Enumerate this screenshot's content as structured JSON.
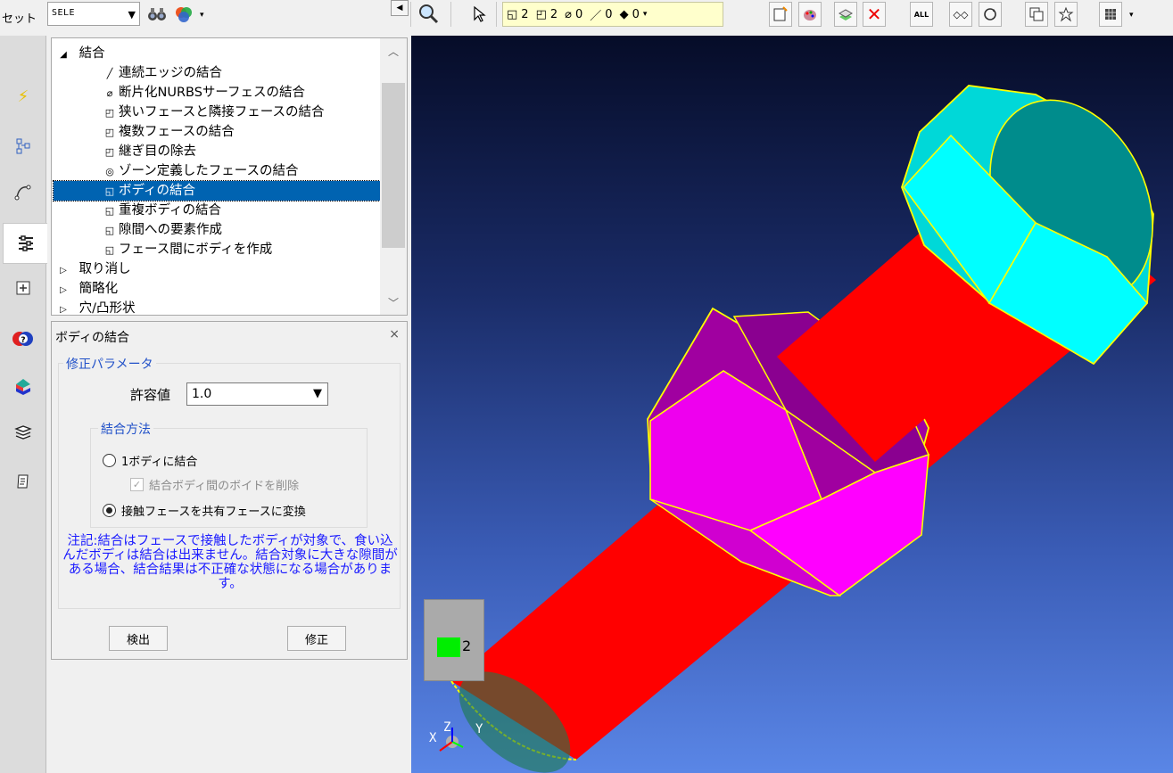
{
  "toolbar": {
    "set_label": "セット",
    "set_value": "SELE",
    "selection_counts": {
      "solid": "2",
      "face": "2",
      "surface": "0",
      "edge": "0",
      "vertex": "0"
    },
    "all_label": "ALL"
  },
  "tree": {
    "items": [
      {
        "label": "結合",
        "icon": "collapse-arrow-icon",
        "level": 0,
        "expanded": true
      },
      {
        "label": "連続エッジの結合",
        "icon": "edge-icon",
        "level": 1
      },
      {
        "label": "断片化NURBSサーフェスの結合",
        "icon": "nurbs-surface-icon",
        "level": 1
      },
      {
        "label": "狭いフェースと隣接フェースの結合",
        "icon": "face-icon",
        "level": 1
      },
      {
        "label": "複数フェースの結合",
        "icon": "face-icon",
        "level": 1
      },
      {
        "label": "継ぎ目の除去",
        "icon": "face-icon",
        "level": 1
      },
      {
        "label": "ゾーン定義したフェースの結合",
        "icon": "zone-icon",
        "level": 1
      },
      {
        "label": "ボディの結合",
        "icon": "solid-icon",
        "level": 1,
        "selected": true
      },
      {
        "label": "重複ボディの結合",
        "icon": "solid-icon",
        "level": 1
      },
      {
        "label": "隙間への要素作成",
        "icon": "solid-icon",
        "level": 1
      },
      {
        "label": "フェース間にボディを作成",
        "icon": "solid-icon",
        "level": 1
      },
      {
        "label": "取り消し",
        "icon": "expand-arrow-icon",
        "level": 0
      },
      {
        "label": "簡略化",
        "icon": "expand-arrow-icon",
        "level": 0
      },
      {
        "label": "穴/凸形状",
        "icon": "expand-arrow-icon",
        "level": 0
      }
    ]
  },
  "panel": {
    "title": "ボディの結合",
    "close": "×",
    "params_group": "修正パラメータ",
    "tolerance_label": "許容値",
    "tolerance_value": "1.0",
    "method_group": "結合方法",
    "option_one_body": "1ボディに結合",
    "option_remove_voids": "結合ボディ間のボイドを削除",
    "option_shared_face": "接触フェースを共有フェースに変換",
    "selected_method": "shared_face",
    "note": "注記:結合はフェースで接触したボディが対象で、食い込んだボディは結合は出来ません。結合対象に大きな隙間がある場合、結合結果は不正確な状態になる場合があります。",
    "detect_button": "検出",
    "fix_button": "修正"
  },
  "viewport": {
    "legend_value": "2",
    "legend_color": "#00ee00",
    "axis_labels": {
      "x": "X",
      "y": "Y",
      "z": "Z"
    },
    "colors": {
      "bolt_shank": "#ff0000",
      "bolt_head": "#00ffff",
      "nut": "#ff00ff",
      "edge_highlight": "#ffff00"
    }
  }
}
